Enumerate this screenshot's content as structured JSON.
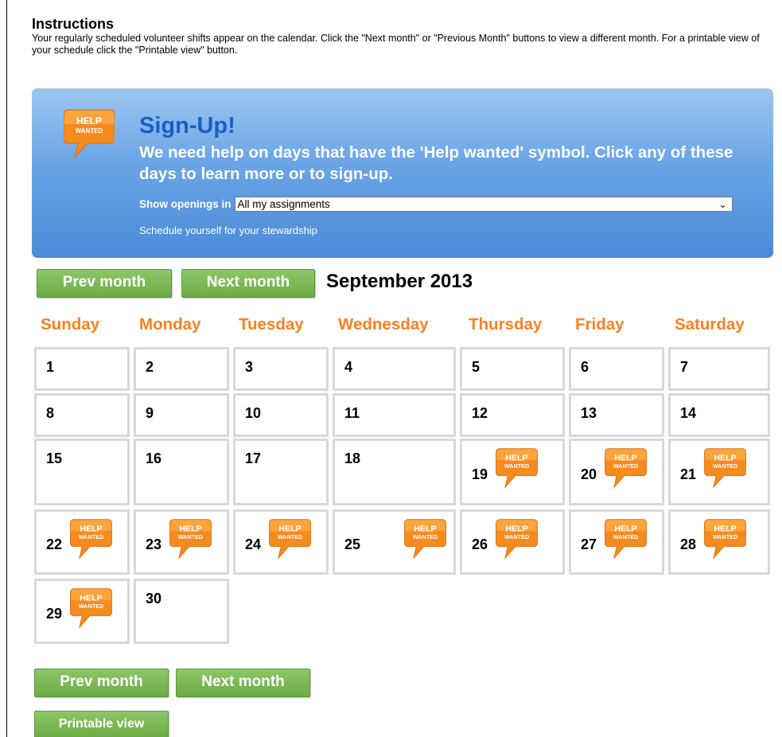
{
  "instructions": {
    "title": "Instructions",
    "text": "Your regularly scheduled volunteer shifts appear on the calendar. Click the \"Next month\" or \"Previous Month\" buttons to view a different month. For a printable view of your schedule click the \"Printable view\" button."
  },
  "signup": {
    "badge_line1": "HELP",
    "badge_line2": "WANTED",
    "title": "Sign-Up!",
    "message": "We need help on days that have the 'Help wanted' symbol. Click any of these days to learn more or to sign-up.",
    "openings_label": "Show openings in",
    "openings_value": "All my assignments",
    "schedule_link": "Schedule yourself for your stewardship"
  },
  "nav": {
    "prev_label": "Prev month",
    "next_label": "Next month",
    "month_title": "September 2013",
    "printable_label": "Printable view"
  },
  "calendar": {
    "day_names": [
      "Sunday",
      "Monday",
      "Tuesday",
      "Wednesday",
      "Thursday",
      "Friday",
      "Saturday"
    ],
    "days": [
      {
        "day": "1",
        "help": false
      },
      {
        "day": "2",
        "help": false
      },
      {
        "day": "3",
        "help": false
      },
      {
        "day": "4",
        "help": false
      },
      {
        "day": "5",
        "help": false
      },
      {
        "day": "6",
        "help": false
      },
      {
        "day": "7",
        "help": false
      },
      {
        "day": "8",
        "help": false
      },
      {
        "day": "9",
        "help": false
      },
      {
        "day": "10",
        "help": false
      },
      {
        "day": "11",
        "help": false
      },
      {
        "day": "12",
        "help": false
      },
      {
        "day": "13",
        "help": false
      },
      {
        "day": "14",
        "help": false
      },
      {
        "day": "15",
        "help": false
      },
      {
        "day": "16",
        "help": false
      },
      {
        "day": "17",
        "help": false
      },
      {
        "day": "18",
        "help": false
      },
      {
        "day": "19",
        "help": true
      },
      {
        "day": "20",
        "help": true
      },
      {
        "day": "21",
        "help": true
      },
      {
        "day": "22",
        "help": true
      },
      {
        "day": "23",
        "help": true
      },
      {
        "day": "24",
        "help": true
      },
      {
        "day": "25",
        "help": true
      },
      {
        "day": "26",
        "help": true
      },
      {
        "day": "27",
        "help": true
      },
      {
        "day": "28",
        "help": true
      },
      {
        "day": "29",
        "help": true
      },
      {
        "day": "30",
        "help": false
      }
    ]
  },
  "colors": {
    "accent_orange": "#ff7f1f",
    "button_green": "#6cab45",
    "banner_blue": "#4a8ad8",
    "title_blue": "#1a5fc6"
  }
}
